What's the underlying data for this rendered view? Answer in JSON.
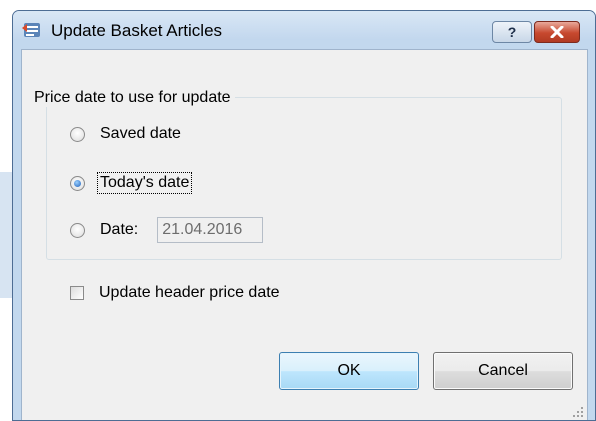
{
  "window": {
    "title": "Update Basket Articles",
    "help_label": "?",
    "close_icon": "close-icon"
  },
  "group": {
    "label": "Price date to use for update",
    "options": [
      {
        "label": "Saved date",
        "checked": false
      },
      {
        "label": "Today's date",
        "checked": true
      },
      {
        "label": "Date:",
        "checked": false
      }
    ],
    "date_value": "21.04.2016"
  },
  "header_option": {
    "label": "Update header price date",
    "checked": false
  },
  "buttons": {
    "ok_label": "OK",
    "cancel_label": "Cancel"
  },
  "colors": {
    "accent": "#3c7fb1",
    "close": "#c7492f",
    "frame": "#c2d8ee"
  }
}
